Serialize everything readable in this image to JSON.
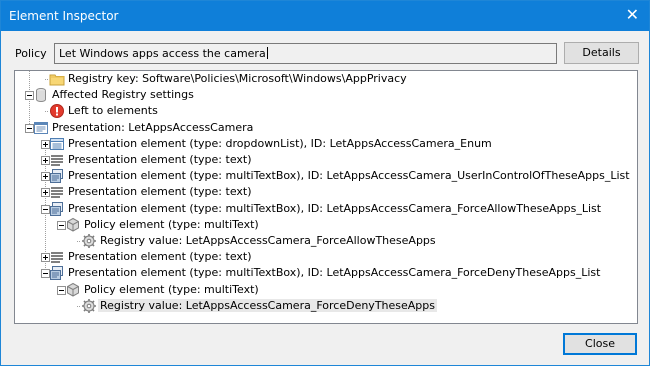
{
  "window": {
    "title": "Element Inspector",
    "close_glyph": "✕"
  },
  "policy": {
    "label": "Policy",
    "value": "Let Windows apps access the camera"
  },
  "buttons": {
    "details": "Details",
    "close": "Close"
  },
  "tree": [
    {
      "text": "Registry key: Software\\Policies\\Microsoft\\Windows\\AppPrivacy",
      "icon": "folder-icon",
      "expander": "none",
      "level": 1
    },
    {
      "text": "Affected Registry settings",
      "icon": "database-icon",
      "expander": "minus",
      "level": 0
    },
    {
      "text": "Left to elements",
      "icon": "error-icon",
      "expander": "none",
      "level": 1
    },
    {
      "text": "Presentation: LetAppsAccessCamera",
      "icon": "presentation-icon",
      "expander": "minus",
      "level": 0
    },
    {
      "text": "Presentation element (type: dropdownList), ID: LetAppsAccessCamera_Enum",
      "icon": "dropdown-list-icon",
      "expander": "plus",
      "level": 1
    },
    {
      "text": "Presentation element (type: text)",
      "icon": "text-lines-icon",
      "expander": "plus",
      "level": 1
    },
    {
      "text": "Presentation element (type: multiTextBox), ID: LetAppsAccessCamera_UserInControlOfTheseApps_List",
      "icon": "multitextbox-icon",
      "expander": "plus",
      "level": 1
    },
    {
      "text": "Presentation element (type: text)",
      "icon": "text-lines-icon",
      "expander": "plus",
      "level": 1
    },
    {
      "text": "Presentation element (type: multiTextBox), ID: LetAppsAccessCamera_ForceAllowTheseApps_List",
      "icon": "multitextbox-icon",
      "expander": "minus",
      "level": 1
    },
    {
      "text": "Policy element (type: multiText)",
      "icon": "cube-icon",
      "expander": "minus",
      "level": 2
    },
    {
      "text": "Registry value: LetAppsAccessCamera_ForceAllowTheseApps",
      "icon": "gear-icon",
      "expander": "none",
      "level": 3
    },
    {
      "text": "Presentation element (type: text)",
      "icon": "text-lines-icon",
      "expander": "plus",
      "level": 1
    },
    {
      "text": "Presentation element (type: multiTextBox), ID: LetAppsAccessCamera_ForceDenyTheseApps_List",
      "icon": "multitextbox-icon",
      "expander": "minus",
      "level": 1
    },
    {
      "text": "Policy element (type: multiText)",
      "icon": "cube-icon",
      "expander": "minus",
      "level": 2
    },
    {
      "text": "Registry value: LetAppsAccessCamera_ForceDenyTheseApps",
      "icon": "gear-icon",
      "expander": "none",
      "level": 3,
      "selected": true
    }
  ]
}
